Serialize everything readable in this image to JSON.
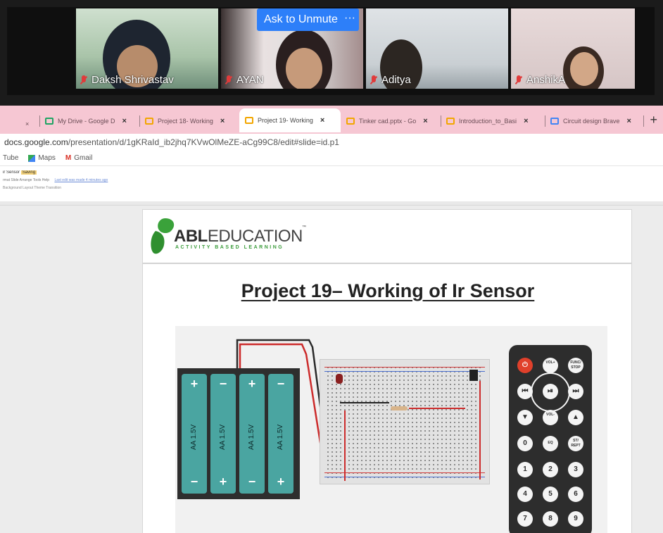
{
  "meeting": {
    "participants": [
      {
        "name": "Daksh Shrivastav"
      },
      {
        "name": "AYAN"
      },
      {
        "name": "Aditya"
      },
      {
        "name": "AnshikA"
      }
    ],
    "ask_to_unmute_label": "Ask to Unmute",
    "more_label": "···"
  },
  "browser": {
    "tabs": [
      {
        "label": "My Drive - Google D"
      },
      {
        "label": "Project 18- Working"
      },
      {
        "label": "Project 19- Working"
      },
      {
        "label": "Tinker cad.pptx - Go"
      },
      {
        "label": "Introduction_to_Basi"
      },
      {
        "label": "Circuit design Brave"
      }
    ],
    "close_label": "×",
    "new_tab_label": "+",
    "url_domain": "docs.google.com",
    "url_path": "/presentation/d/1gKRaId_ib2jhq7KVwOlMeZE-aCg99C8/edit#slide=id.p1",
    "bookmarks": [
      {
        "label": "Tube"
      },
      {
        "label": "Maps"
      },
      {
        "label": "Gmail"
      }
    ]
  },
  "slides_app": {
    "doc_title": "ir Sensor",
    "doc_badge": "Saving",
    "menu": "rmat  Slide  Arrange  Tools  Help",
    "last_edit": "Last edit was made 4 minutes ago",
    "toolbar": "Background   Layout   Theme   Transition"
  },
  "slide": {
    "logo_bold": "ABL",
    "logo_light": "EDUCATION",
    "logo_tm": "™",
    "logo_tagline": "ACTIVITY BASED LEARNING",
    "title": "Project 19– Working of Ir Sensor",
    "battery_cells": [
      {
        "label": "AA 1.5V"
      },
      {
        "label": "AA 1.5V"
      },
      {
        "label": "AA 1.5V"
      },
      {
        "label": "AA 1.5V"
      }
    ],
    "remote_buttons": {
      "power": "⏻",
      "vol_up": "VOL+",
      "func_stop": "FUNC/ STOP",
      "prev": "⏮",
      "play_pause": "⏯",
      "next": "⏭",
      "down": "▼",
      "vol_down": "VOL-",
      "up": "▲",
      "zero": "0",
      "eq": "EQ",
      "st_rept": "ST/ REPT",
      "one": "1",
      "two": "2",
      "three": "3",
      "four": "4",
      "five": "5",
      "six": "6",
      "seven": "7",
      "eight": "8",
      "nine": "9"
    }
  },
  "colors": {
    "tabbar": "#f6c7d3",
    "unmute_blue": "#2d7ff9",
    "battery_teal": "#4aa5a1",
    "logo_green": "#3a9b3a",
    "power_red": "#e0402b"
  }
}
